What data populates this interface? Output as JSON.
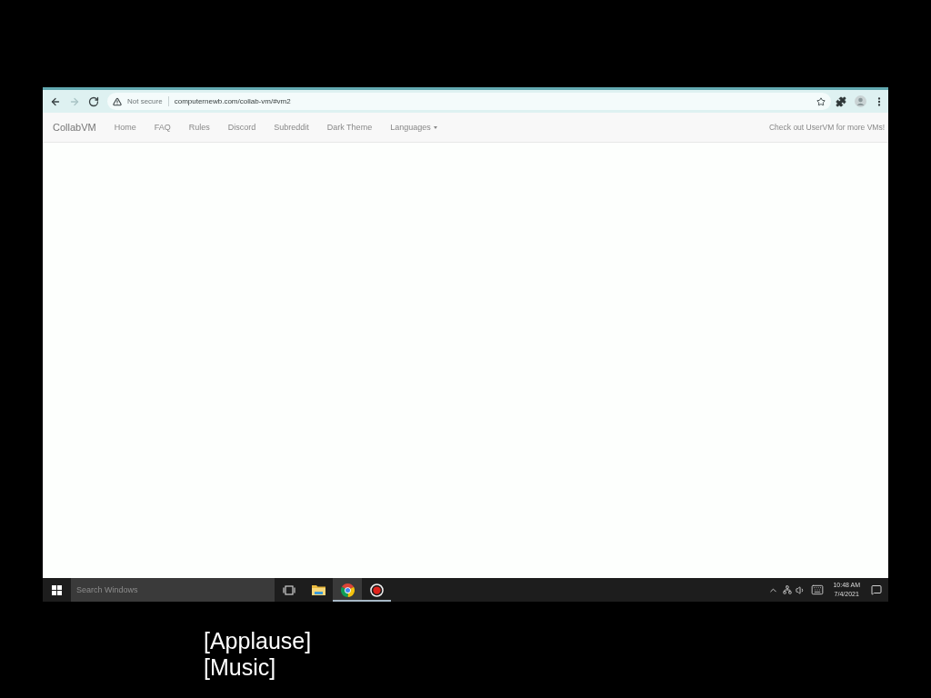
{
  "browser": {
    "nav_buttons": [
      {
        "kind": "back",
        "disabled": false
      },
      {
        "kind": "forward",
        "disabled": true
      },
      {
        "kind": "reload",
        "disabled": false
      }
    ],
    "address_bar": {
      "security_label": "Not secure",
      "url": "computernewb.com/collab-vm/#vm2"
    }
  },
  "navbar": {
    "brand": "CollabVM",
    "links": [
      {
        "label": "Home",
        "kind": "link"
      },
      {
        "label": "FAQ",
        "kind": "link"
      },
      {
        "label": "Rules",
        "kind": "link"
      },
      {
        "label": "Discord",
        "kind": "link"
      },
      {
        "label": "Subreddit",
        "kind": "link"
      },
      {
        "label": "Dark Theme",
        "kind": "link"
      },
      {
        "label": "Languages",
        "kind": "dropdown"
      }
    ],
    "notice": "Check out UserVM for more VMs!"
  },
  "taskbar": {
    "search": {
      "placeholder": "Search Windows"
    },
    "apps": [
      {
        "kind": "task-view",
        "running": false,
        "selected": false
      },
      {
        "kind": "file-explorer",
        "running": false,
        "selected": false
      },
      {
        "kind": "chrome",
        "running": true,
        "selected": true
      },
      {
        "kind": "recorder",
        "running": true,
        "selected": false
      }
    ],
    "clock": {
      "time": "10:48 AM",
      "date": "7/4/2021"
    }
  },
  "captions": [
    "[Applause]",
    "[Music]"
  ]
}
